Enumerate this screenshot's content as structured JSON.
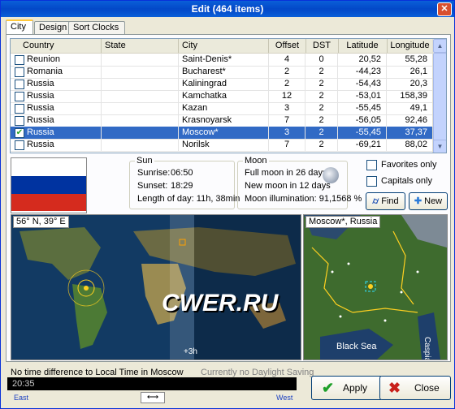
{
  "window": {
    "title": "Edit (464 items)",
    "close_symbol": "✕"
  },
  "tabs": [
    "City",
    "Design",
    "Sort Clocks"
  ],
  "grid": {
    "columns": [
      "Country",
      "State",
      "City",
      "Offset",
      "DST",
      "Latitude",
      "Longitude"
    ],
    "rows": [
      {
        "checked": false,
        "country": "Reunion",
        "state": "",
        "city": "Saint-Denis*",
        "offset": "4",
        "dst": "0",
        "lat": "20,52",
        "lon": "55,28"
      },
      {
        "checked": false,
        "country": "Romania",
        "state": "",
        "city": "Bucharest*",
        "offset": "2",
        "dst": "2",
        "lat": "-44,23",
        "lon": "26,1"
      },
      {
        "checked": false,
        "country": "Russia",
        "state": "",
        "city": "Kaliningrad",
        "offset": "2",
        "dst": "2",
        "lat": "-54,43",
        "lon": "20,3"
      },
      {
        "checked": false,
        "country": "Russia",
        "state": "",
        "city": "Kamchatka",
        "offset": "12",
        "dst": "2",
        "lat": "-53,01",
        "lon": "158,39"
      },
      {
        "checked": false,
        "country": "Russia",
        "state": "",
        "city": "Kazan",
        "offset": "3",
        "dst": "2",
        "lat": "-55,45",
        "lon": "49,1"
      },
      {
        "checked": false,
        "country": "Russia",
        "state": "",
        "city": "Krasnoyarsk",
        "offset": "7",
        "dst": "2",
        "lat": "-56,05",
        "lon": "92,46"
      },
      {
        "checked": true,
        "country": "Russia",
        "state": "",
        "city": "Moscow*",
        "offset": "3",
        "dst": "2",
        "lat": "-55,45",
        "lon": "37,37",
        "selected": true
      },
      {
        "checked": false,
        "country": "Russia",
        "state": "",
        "city": "Norilsk",
        "offset": "7",
        "dst": "2",
        "lat": "-69,21",
        "lon": "88,02"
      }
    ]
  },
  "flag_colors": [
    "#ffffff",
    "#0033a0",
    "#d52b1e"
  ],
  "sun": {
    "label": "Sun",
    "sunrise_label": "Sunrise:",
    "sunrise": "06:50",
    "sunset_label": "Sunset:",
    "sunset": "18:29",
    "daylength": "Length of day: 11h, 38min"
  },
  "moon": {
    "label": "Moon",
    "full": "Full moon in 26 days",
    "new": "New moon in 12 days",
    "illum": "Moon illumination: 91,1568 %"
  },
  "filters": {
    "favorites": "Favorites only",
    "capitals": "Capitals only"
  },
  "buttons": {
    "find": "Find",
    "new": "New",
    "apply": "Apply",
    "close": "Close"
  },
  "world_map": {
    "coords": "56° N, 39° E",
    "offset_label": "+3h",
    "watermark": "CWER.RU"
  },
  "local_map": {
    "label": "Moscow*, Russia",
    "sea": "Black Sea",
    "sea2": "Caspian"
  },
  "status": {
    "time_diff": "No time difference to Local Time in Moscow",
    "dst_note": "Currently no Daylight Saving",
    "time": "20:35",
    "east": "East",
    "west": "West",
    "swap": "⟷"
  }
}
